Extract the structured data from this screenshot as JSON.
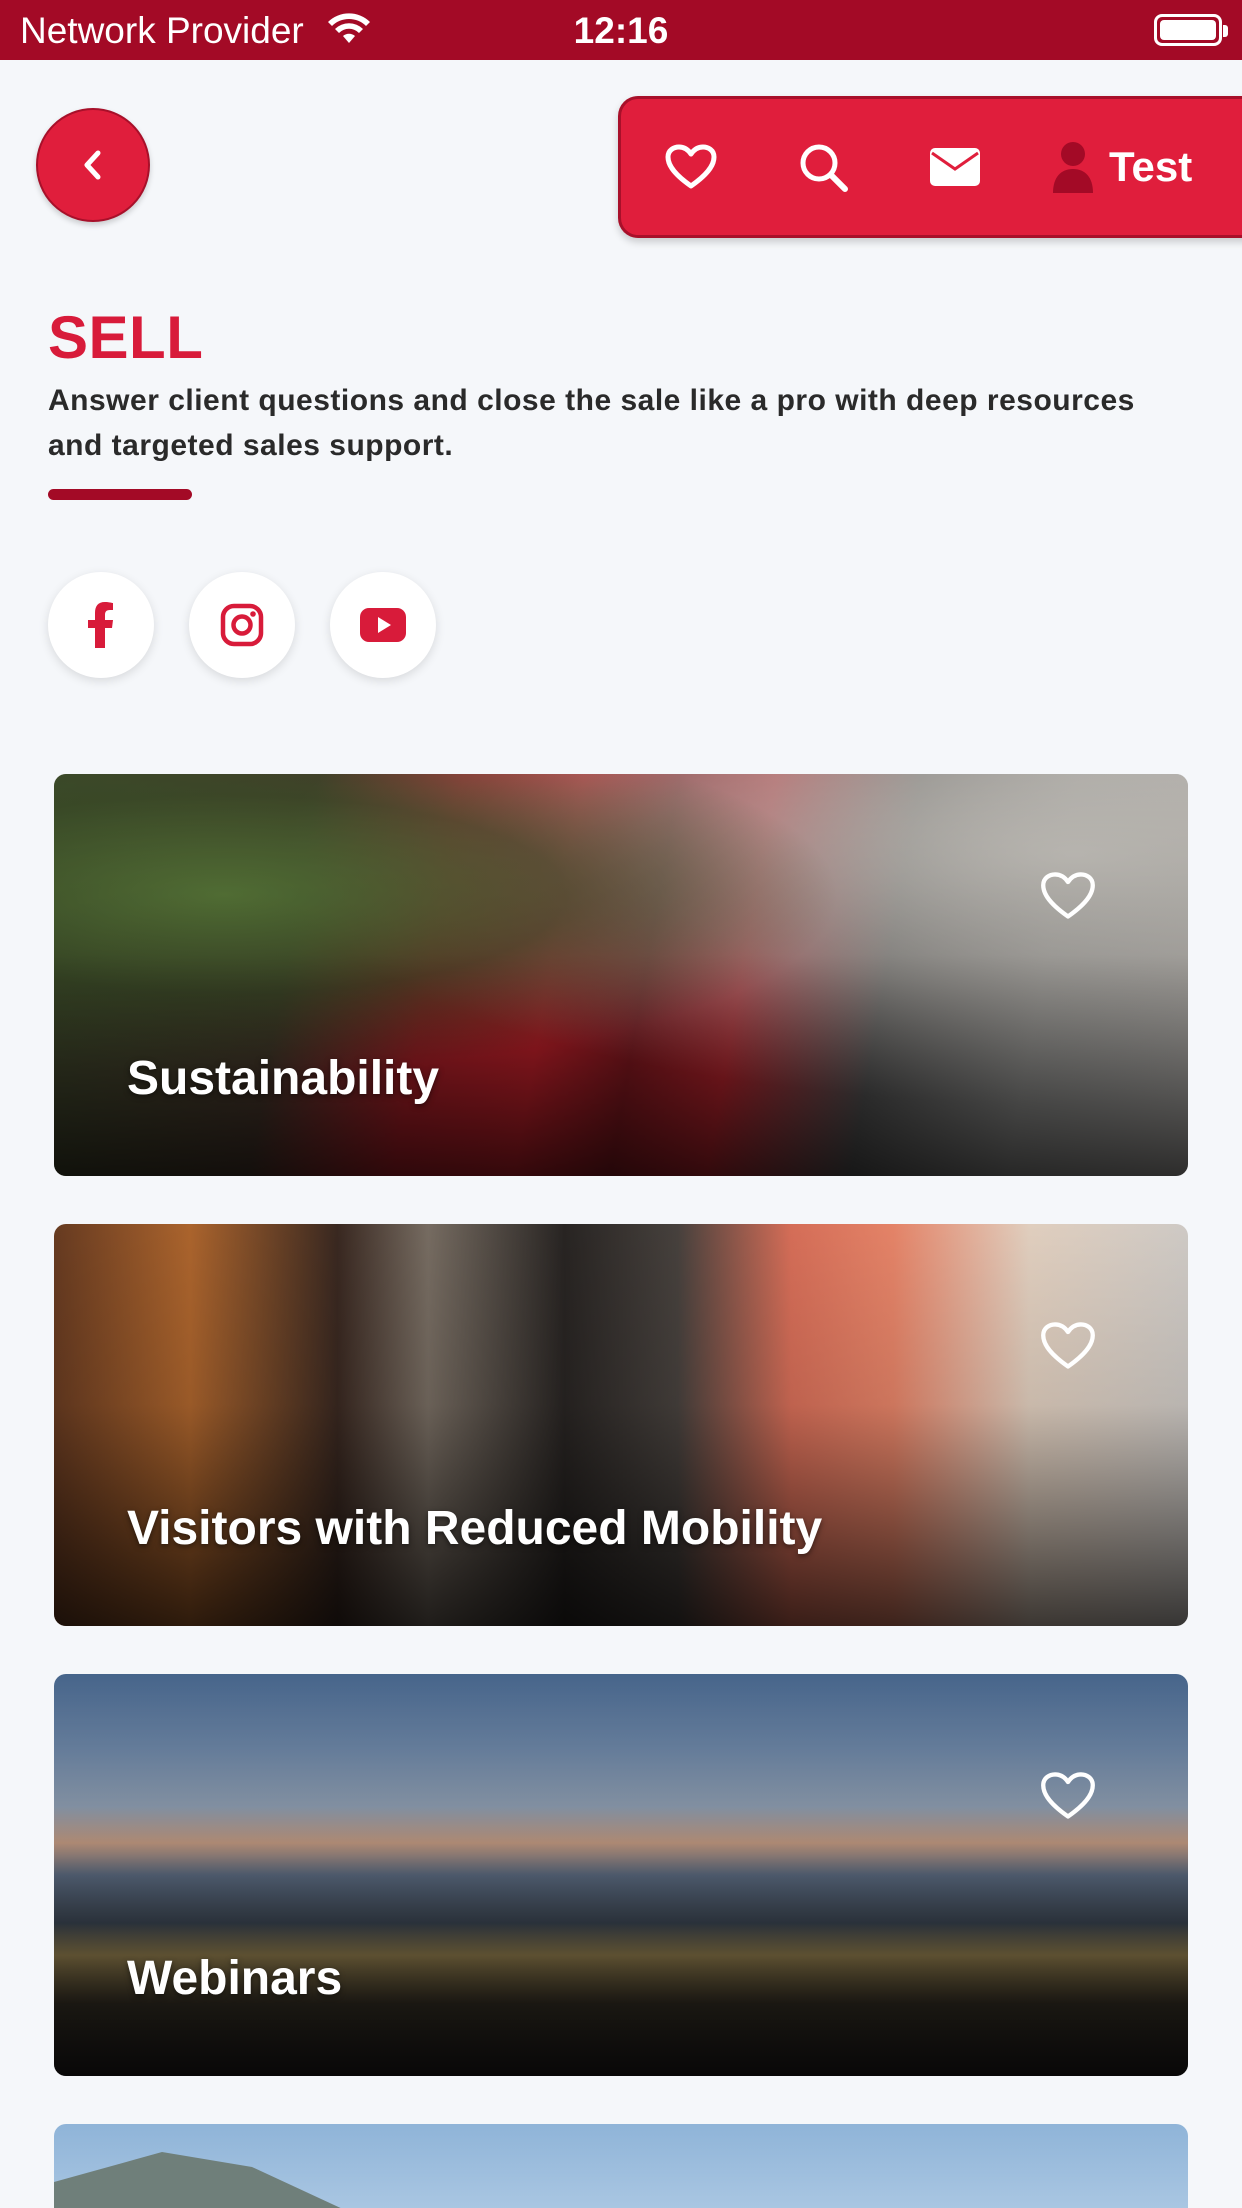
{
  "status_bar": {
    "carrier": "Network Provider",
    "time": "12:16"
  },
  "header": {
    "user_name": "Test"
  },
  "intro": {
    "title": "SELL",
    "description": "Answer client questions and close the sale like a pro with deep resources and targeted sales support."
  },
  "social": [
    "facebook-icon",
    "instagram-icon",
    "youtube-icon"
  ],
  "cards": [
    {
      "title": "Sustainability"
    },
    {
      "title": "Visitors with Reduced Mobility"
    },
    {
      "title": "Webinars"
    },
    {
      "title": ""
    }
  ],
  "colors": {
    "status_bar": "#a30a26",
    "accent": "#e01e3c",
    "accent_dark": "#a30a26",
    "title": "#d81b3a",
    "background": "#f5f7fa"
  }
}
